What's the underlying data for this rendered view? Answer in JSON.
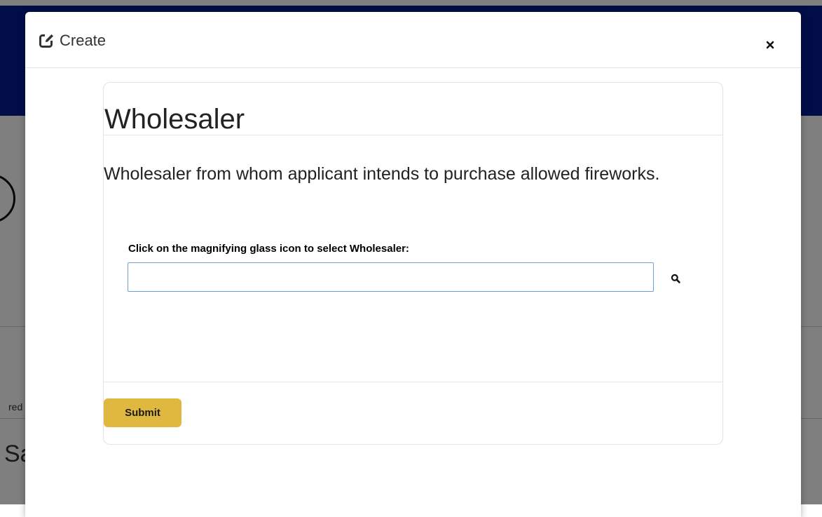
{
  "background": {
    "partial_text_small": "red",
    "partial_text_large": "Sa"
  },
  "modal": {
    "title": "Create",
    "title_icon": "edit-icon",
    "close_icon": "close-icon"
  },
  "form": {
    "heading": "Wholesaler",
    "description": "Wholesaler from whom applicant intends to purchase allowed fireworks.",
    "field_label": "Click on the magnifying glass icon to select Wholesaler:",
    "field_value": "",
    "field_placeholder": "",
    "search_icon": "search-icon",
    "submit_label": "Submit"
  },
  "colors": {
    "header_blue": "#001a8f",
    "submit_gold": "#e0b840",
    "input_border": "#6f9fd8"
  }
}
